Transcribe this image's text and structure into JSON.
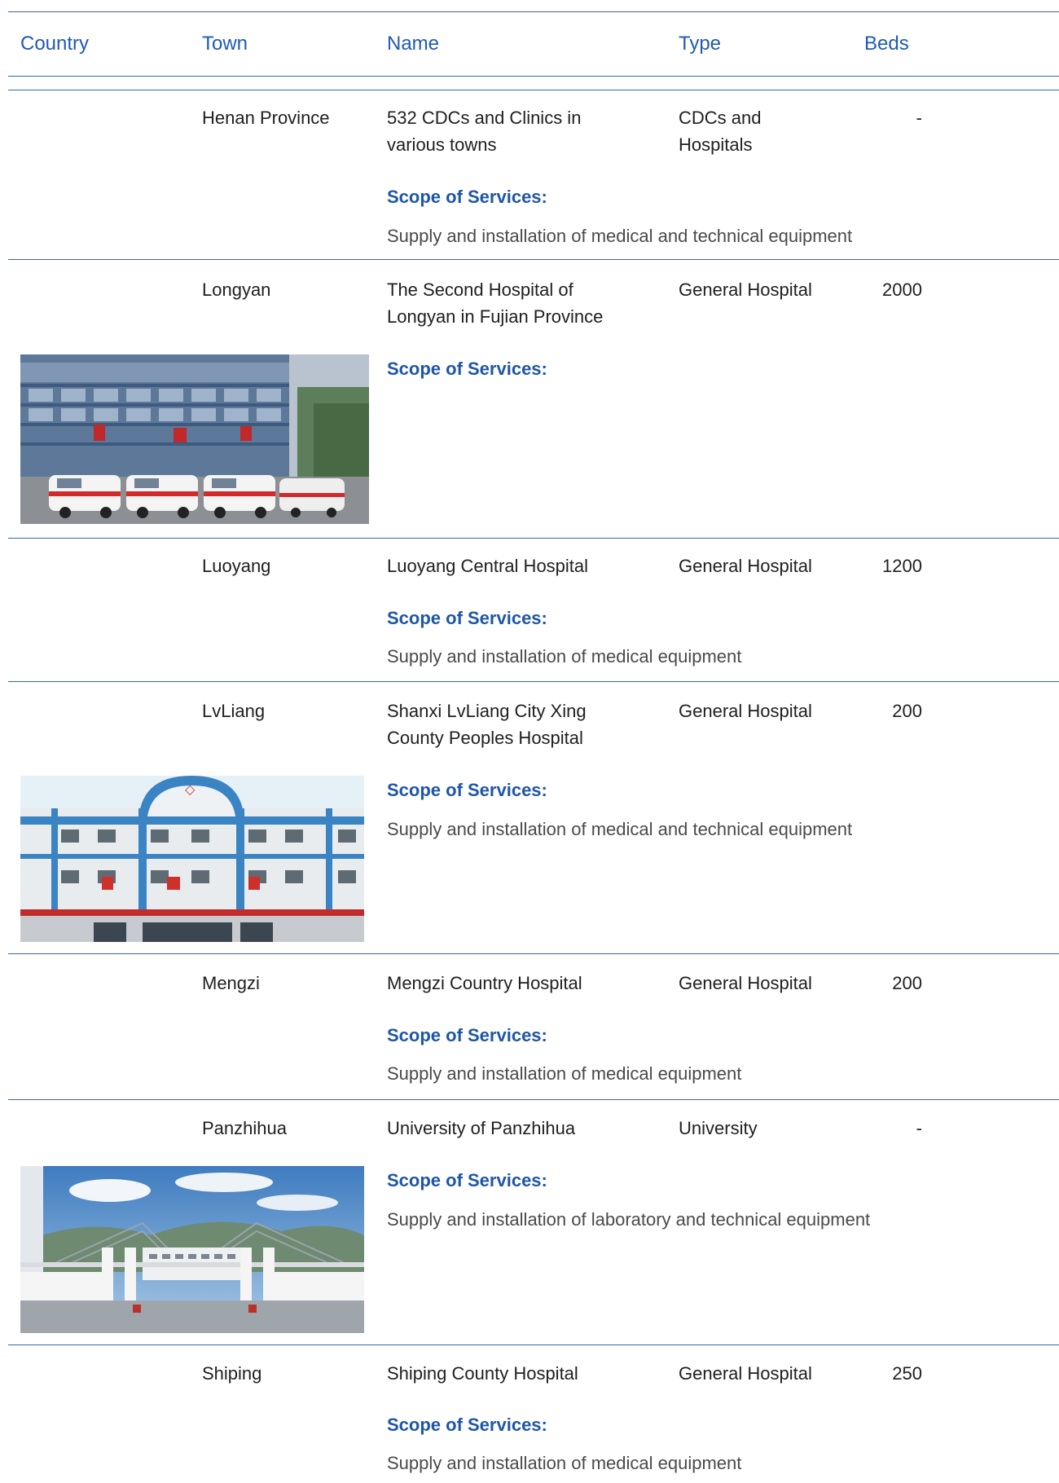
{
  "header": {
    "country": "Country",
    "town": "Town",
    "name": "Name",
    "type": "Type",
    "beds": "Beds"
  },
  "scope_label": "Scope of Services:",
  "rows": [
    {
      "country": "",
      "town": "Henan Province",
      "name": "532 CDCs and Clinics in various towns",
      "name_lines": [
        "532 CDCs and Clinics in",
        "various towns"
      ],
      "type": "CDCs and Hospitals",
      "type_lines": [
        "CDCs and",
        "Hospitals"
      ],
      "beds": "-",
      "scope": "Supply and installation of medical and technical equipment"
    },
    {
      "country": "",
      "town": "Longyan",
      "name": "The Second Hospital of Longyan in Fujian Province",
      "name_lines": [
        "The Second Hospital of",
        "Longyan in Fujian Province"
      ],
      "type": "General Hospital",
      "beds": "2000",
      "scope": "",
      "photo": "hospital-with-ambulances"
    },
    {
      "country": "",
      "town": "Luoyang",
      "name": "Luoyang Central Hospital",
      "type": "General Hospital",
      "beds": "1200",
      "scope": "Supply and installation of medical equipment"
    },
    {
      "country": "",
      "town": "LvLiang",
      "name": "Shanxi LvLiang City Xing County Peoples Hospital",
      "name_lines": [
        "Shanxi LvLiang City Xing",
        "County Peoples Hospital"
      ],
      "type": "General Hospital",
      "beds": "200",
      "scope": "Supply and installation of medical and technical equipment",
      "photo": "hospital-building-arch"
    },
    {
      "country": "",
      "town": "Mengzi",
      "name": "Mengzi Country Hospital",
      "type": "General Hospital",
      "beds": "200",
      "scope": "Supply and installation of medical equipment"
    },
    {
      "country": "",
      "town": "Panzhihua",
      "name": "University of Panzhihua",
      "type": "University",
      "beds": "-",
      "scope": "Supply and installation of laboratory and technical equipment",
      "photo": "university-gate"
    },
    {
      "country": "",
      "town": "Shiping",
      "name": "Shiping County Hospital",
      "type": "General Hospital",
      "beds": "250",
      "scope": "Supply and installation of medical equipment"
    }
  ]
}
